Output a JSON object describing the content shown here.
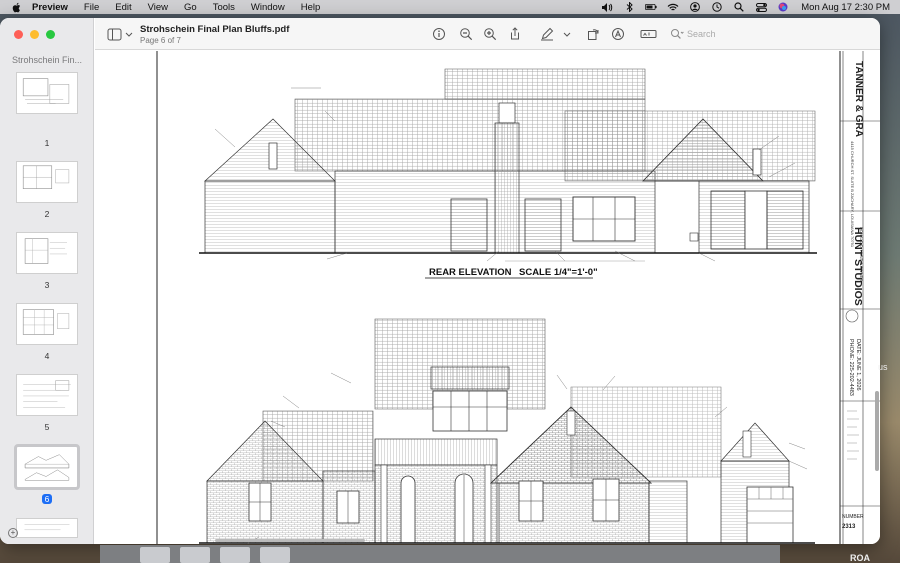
{
  "menubar": {
    "app_name": "Preview",
    "menus": [
      "File",
      "Edit",
      "View",
      "Go",
      "Tools",
      "Window",
      "Help"
    ],
    "clock": "Mon Aug 17  2:30 PM"
  },
  "window": {
    "doc_title": "Strohschein Final Plan Bluffs.pdf",
    "page_indicator": "Page 6 of 7",
    "sidebar_title": "Strohschein Fin...",
    "search_placeholder": "Search",
    "thumbnails": [
      {
        "label": "1"
      },
      {
        "label": "2"
      },
      {
        "label": "3"
      },
      {
        "label": "4"
      },
      {
        "label": "5"
      },
      {
        "label": "6"
      }
    ],
    "selected_page": "6"
  },
  "drawing": {
    "rear_label": "REAR ELEVATION",
    "rear_scale": "SCALE 1/4\"=1'-0\"",
    "firm_name": "TANNER & GRA",
    "studio_name": "HUNT STUDIOS",
    "studio_sub": "DONALD D. HUNT & OWNER",
    "address": "4415 CHURCH ST. SUITE B  ZACHARY, LOUISIANA 70791",
    "phone": "PHONE: 225-202-4483",
    "date": "DATE: JUNE 1, 2026",
    "number_label": "NUMBER",
    "number": "2313"
  },
  "background": {
    "right_text": "us",
    "bottom_text": "ROA"
  }
}
